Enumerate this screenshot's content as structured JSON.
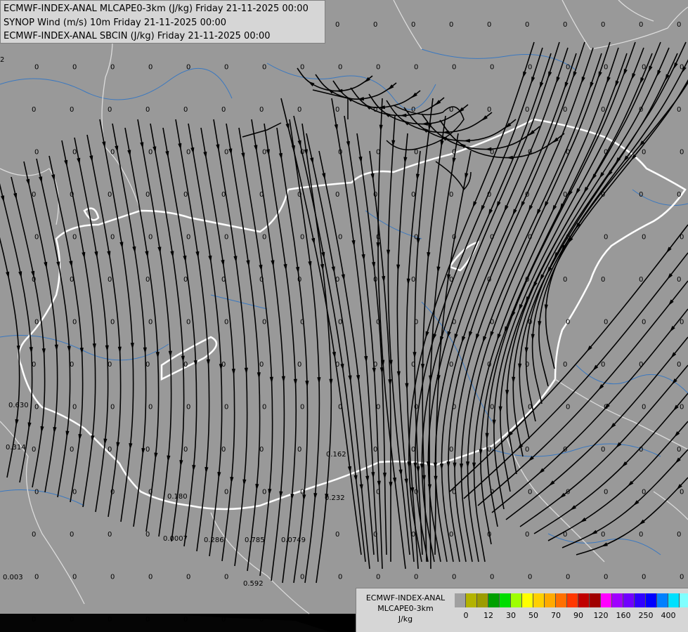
{
  "header": {
    "lines": [
      "ECMWF-INDEX-ANAL MLCAPE0-3km (J/kg) Friday 21-11-2025 00:00",
      "SYNOP Wind (m/s) 10m Friday 21-11-2025 00:00",
      "ECMWF-INDEX-ANAL SBCIN (J/kg) Friday 21-11-2025 00:00"
    ]
  },
  "map": {
    "background_color": "#999999",
    "border_color": "#ffffff",
    "river_color": "#3a78c0",
    "streamline_color": "#000000",
    "value_labels": [
      {
        "text": "0",
        "col": 0,
        "row": 0
      },
      {
        "text": "0",
        "col": 1,
        "row": 0
      },
      {
        "text": "0",
        "col": 2,
        "row": 0
      },
      {
        "text": "0.630"
      },
      {
        "text": "0.314"
      },
      {
        "text": "0.003"
      },
      {
        "text": "0.162"
      },
      {
        "text": "0.232"
      },
      {
        "text": "0.180"
      },
      {
        "text": "0.0007"
      },
      {
        "text": "0.286"
      },
      {
        "text": "0.785"
      },
      {
        "text": "0.0749"
      },
      {
        "text": "0.592"
      },
      {
        "text": "2"
      }
    ]
  },
  "legend": {
    "title_lines": [
      "ECMWF-INDEX-ANAL",
      "MLCAPE0-3km",
      "J/kg"
    ],
    "colors": [
      "#a0a0a0",
      "#b3b300",
      "#9c9c00",
      "#00a000",
      "#00dd00",
      "#9eff00",
      "#ffff00",
      "#ffd000",
      "#ffaa00",
      "#ff7000",
      "#ff3800",
      "#c00000",
      "#a00000",
      "#ff00ff",
      "#a000ff",
      "#7000ff",
      "#3000ff",
      "#0000ff",
      "#0080ff",
      "#00e0ff",
      "#80ffff",
      "#ffffff"
    ],
    "ticks": [
      "0",
      "12",
      "30",
      "50",
      "70",
      "90",
      "120",
      "160",
      "250",
      "400"
    ]
  }
}
